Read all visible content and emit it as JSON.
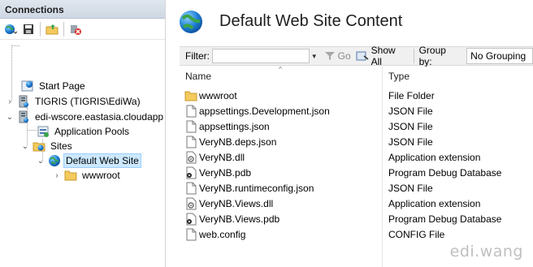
{
  "connections": {
    "header": "Connections",
    "toolbar_icons": [
      "connect-globe-icon",
      "save-icon",
      "folder-up-icon",
      "disconnect-icon"
    ],
    "tree": [
      {
        "label": "Start Page",
        "icon": "start-page-icon",
        "expander": ""
      },
      {
        "label": "TIGRIS (TIGRIS\\EdiWa)",
        "icon": "server-icon",
        "expander": ">"
      },
      {
        "label": "edi-wscore.eastasia.cloudapp",
        "icon": "server-icon",
        "expander": "v"
      },
      {
        "label": "Application Pools",
        "icon": "app-pools-icon",
        "expander": ""
      },
      {
        "label": "Sites",
        "icon": "sites-folder-icon",
        "expander": "v"
      },
      {
        "label": "Default Web Site",
        "icon": "globe-icon",
        "expander": "v",
        "selected": true
      },
      {
        "label": "wwwroot",
        "icon": "folder-icon",
        "expander": ">"
      }
    ]
  },
  "content": {
    "title": "Default Web Site Content",
    "filter": {
      "label": "Filter:",
      "value": "",
      "go_label": "Go",
      "show_all_label": "Show All",
      "group_by_label": "Group by:",
      "group_by_value": "No Grouping"
    },
    "columns": {
      "name": "Name",
      "type": "Type"
    },
    "files": [
      {
        "name": "wwwroot",
        "type": "File Folder",
        "icon": "folder-icon"
      },
      {
        "name": "appsettings.Development.json",
        "type": "JSON File",
        "icon": "document-icon"
      },
      {
        "name": "appsettings.json",
        "type": "JSON File",
        "icon": "document-icon"
      },
      {
        "name": "VeryNB.deps.json",
        "type": "JSON File",
        "icon": "document-icon"
      },
      {
        "name": "VeryNB.dll",
        "type": "Application extension",
        "icon": "dll-icon"
      },
      {
        "name": "VeryNB.pdb",
        "type": "Program Debug Database",
        "icon": "pdb-icon"
      },
      {
        "name": "VeryNB.runtimeconfig.json",
        "type": "JSON File",
        "icon": "document-icon"
      },
      {
        "name": "VeryNB.Views.dll",
        "type": "Application extension",
        "icon": "dll-icon"
      },
      {
        "name": "VeryNB.Views.pdb",
        "type": "Program Debug Database",
        "icon": "pdb-icon"
      },
      {
        "name": "web.config",
        "type": "CONFIG File",
        "icon": "document-icon"
      }
    ]
  },
  "watermark": "edi.wang",
  "colors": {
    "selection": "#cce8ff",
    "header_bg": "#dfe6ee",
    "folder": "#f4c95d"
  }
}
